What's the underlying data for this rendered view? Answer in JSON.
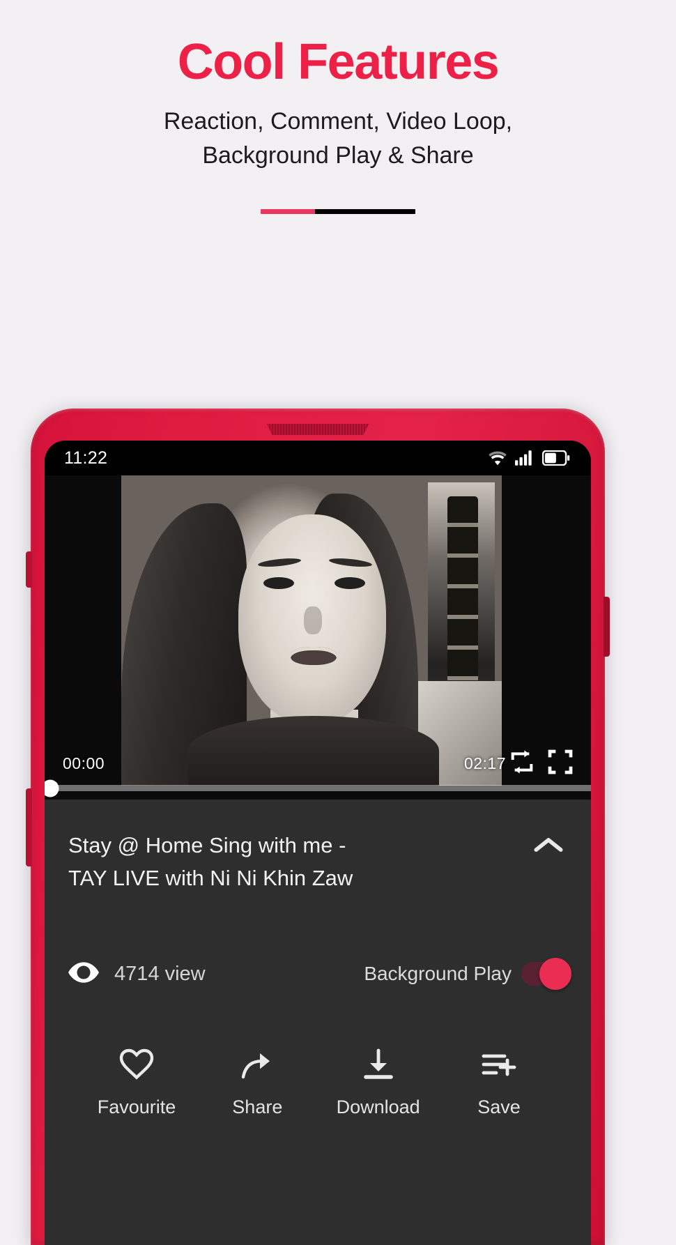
{
  "header": {
    "title": "Cool Features",
    "subtitle_line1": "Reaction, Comment, Video Loop,",
    "subtitle_line2": "Background Play & Share",
    "accent_color": "#ed2048",
    "divider_dark_color": "#000000"
  },
  "phone": {
    "frame_color": "#e42249"
  },
  "status_bar": {
    "time": "11:22",
    "icons": [
      "wifi-icon",
      "cellular-signal-icon",
      "battery-icon"
    ]
  },
  "player": {
    "current_time": "00:00",
    "duration": "02:17",
    "progress_percent": 1.5,
    "loop_icon": "repeat-icon",
    "fullscreen_icon": "fullscreen-icon"
  },
  "info": {
    "title_line1": "Stay @ Home Sing with me -",
    "title_line2": "TAY LIVE with Ni Ni Khin Zaw",
    "collapse_icon": "chevron-up-icon",
    "views_icon": "eye-icon",
    "views_text": "4714 view",
    "background_play_label": "Background Play",
    "background_play_on": true,
    "toggle_color": "#ea2d52"
  },
  "actions": [
    {
      "icon": "heart-icon",
      "label": "Favourite"
    },
    {
      "icon": "share-icon",
      "label": "Share"
    },
    {
      "icon": "download-icon",
      "label": "Download"
    },
    {
      "icon": "playlist-add-icon",
      "label": "Save"
    }
  ]
}
